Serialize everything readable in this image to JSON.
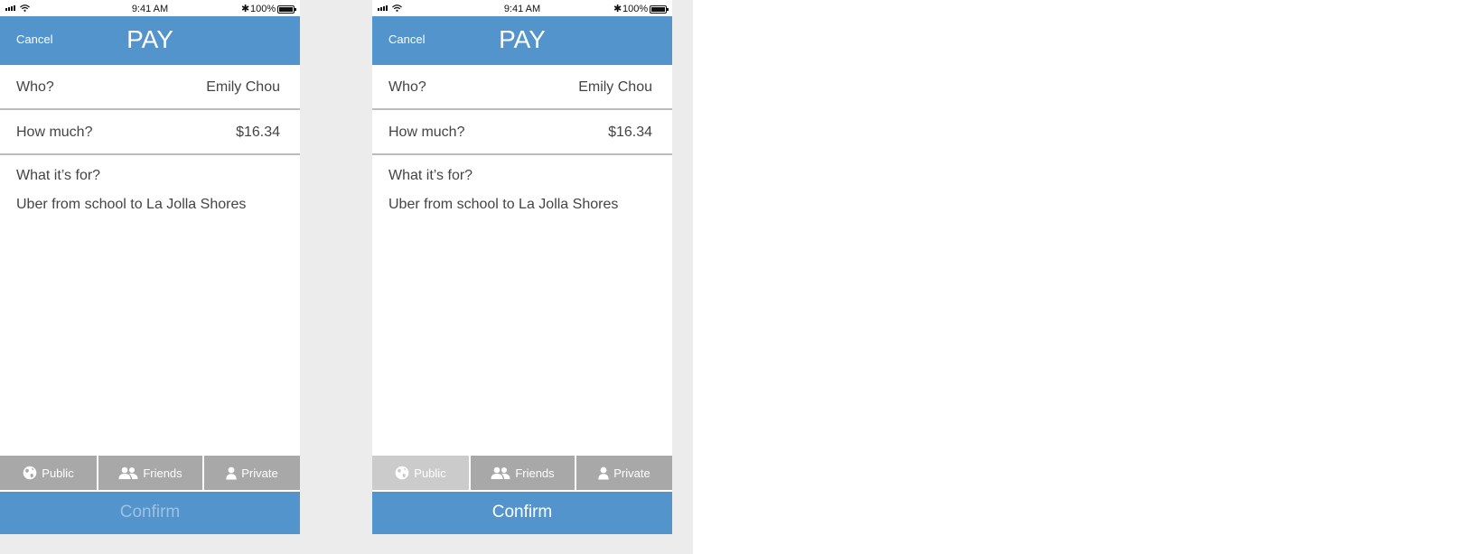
{
  "status_bar": {
    "time": "9:41 AM",
    "battery": "100%",
    "bluetooth_glyph": "✱"
  },
  "screens": [
    {
      "nav": {
        "cancel_label": "Cancel",
        "title": "PAY"
      },
      "who": {
        "label": "Who?",
        "value": "Emily Chou"
      },
      "amount": {
        "label": "How much?",
        "value": "$16.34"
      },
      "note": {
        "label": "What it’s for?",
        "text": "Uber from school to La Jolla Shores"
      },
      "privacy": {
        "options": [
          {
            "label": "Public",
            "icon": "globe-icon"
          },
          {
            "label": "Friends",
            "icon": "friends-icon"
          },
          {
            "label": "Private",
            "icon": "person-icon"
          }
        ],
        "selected": "none"
      },
      "confirm": {
        "label": "Confirm",
        "state": "disabled"
      }
    },
    {
      "nav": {
        "cancel_label": "Cancel",
        "title": "PAY"
      },
      "who": {
        "label": "Who?",
        "value": "Emily Chou"
      },
      "amount": {
        "label": "How much?",
        "value": "$16.34"
      },
      "note": {
        "label": "What it’s for?",
        "text": "Uber from school to La Jolla Shores"
      },
      "privacy": {
        "options": [
          {
            "label": "Public",
            "icon": "globe-icon"
          },
          {
            "label": "Friends",
            "icon": "friends-icon"
          },
          {
            "label": "Private",
            "icon": "person-icon"
          }
        ],
        "selected": "Public"
      },
      "confirm": {
        "label": "Confirm",
        "state": "enabled"
      }
    }
  ],
  "colors": {
    "primary": "#5294cb",
    "privacy_default": "#a8a8a8",
    "privacy_selected": "#cbcbcb",
    "divider": "#bbbbbb",
    "text": "#444444",
    "confirm_disabled_text": "#9fc1e0",
    "background_panel": "#ececec"
  }
}
